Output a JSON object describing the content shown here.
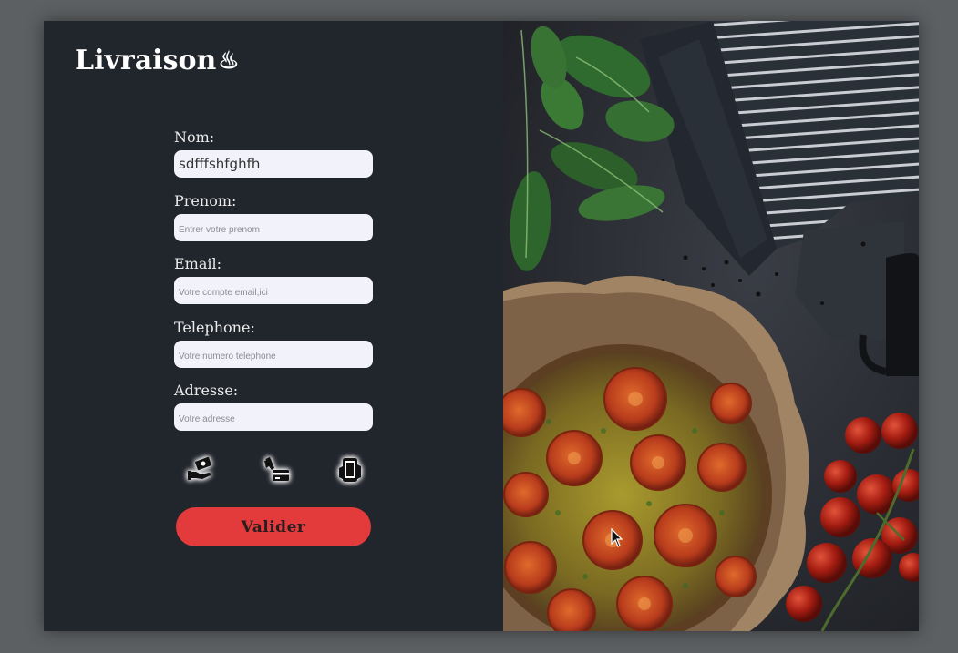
{
  "brand": {
    "title": "Livraison",
    "icon": "hot-springs-icon",
    "icon_glyph": "♨"
  },
  "form": {
    "nom": {
      "label": "Nom:",
      "value": "sdfffshfghfh",
      "placeholder": ""
    },
    "prenom": {
      "label": "Prenom:",
      "value": "",
      "placeholder": "Entrer votre prenom"
    },
    "email": {
      "label": "Email:",
      "value": "",
      "placeholder": "Votre compte email,ici"
    },
    "telephone": {
      "label": "Telephone:",
      "value": "",
      "placeholder": "Votre numero telephone"
    },
    "adresse": {
      "label": "Adresse:",
      "value": "",
      "placeholder": "Votre adresse"
    }
  },
  "payments": [
    {
      "icon": "cash-payment-icon"
    },
    {
      "icon": "card-payment-icon"
    },
    {
      "icon": "mobile-payment-icon"
    }
  ],
  "submit_label": "Valider",
  "colors": {
    "panel": "#21252c",
    "accent": "#e33b3b",
    "input_bg": "#f2f3fa"
  }
}
